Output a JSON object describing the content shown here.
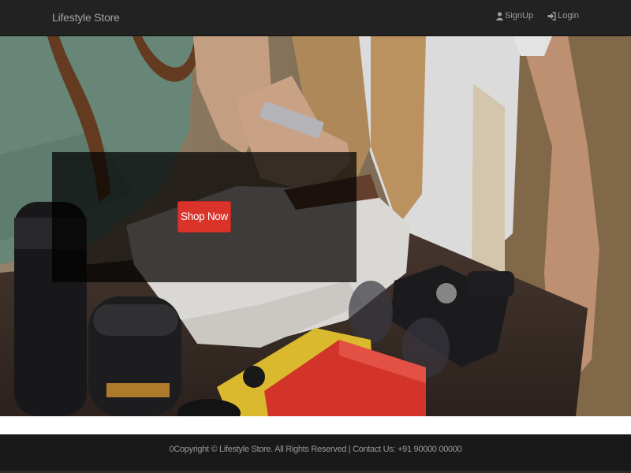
{
  "navbar": {
    "brand": "Lifestyle Store",
    "links": [
      {
        "label": "SignUp",
        "icon": "user-icon"
      },
      {
        "label": "Login",
        "icon": "login-icon"
      }
    ]
  },
  "hero": {
    "background": "product-lifestyle-photo",
    "button_label": "Shop Now"
  },
  "footer": {
    "text": "0Copyright © Lifestyle Store. All Rights Reserved | Contact Us: +91 90000 00000"
  },
  "colors": {
    "navbar_bg": "#222222",
    "accent_button": "#d9332a",
    "footer_bg": "#191919"
  }
}
